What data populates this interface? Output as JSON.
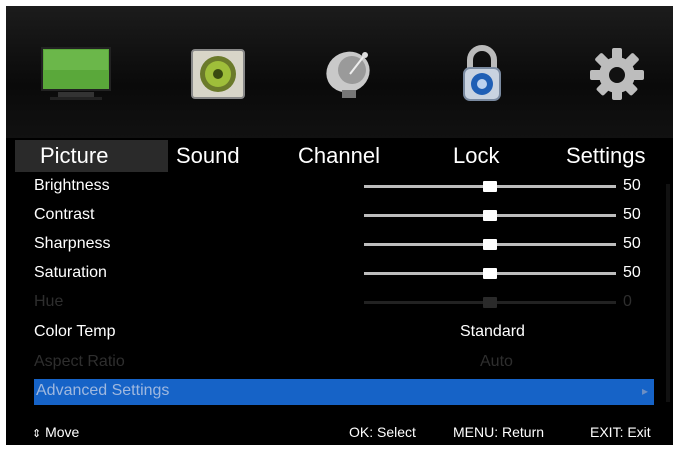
{
  "tabs": [
    {
      "label": "Picture",
      "active": true
    },
    {
      "label": "Sound",
      "active": false
    },
    {
      "label": "Channel",
      "active": false
    },
    {
      "label": "Lock",
      "active": false
    },
    {
      "label": "Settings",
      "active": false
    }
  ],
  "icons": [
    "monitor-icon",
    "speaker-icon",
    "satellite-dish-icon",
    "padlock-icon",
    "gear-icon"
  ],
  "rows": [
    {
      "label": "Brightness",
      "value": "50",
      "level": 0.5,
      "enabled": true
    },
    {
      "label": "Contrast",
      "value": "50",
      "level": 0.5,
      "enabled": true
    },
    {
      "label": "Sharpness",
      "value": "50",
      "level": 0.5,
      "enabled": true
    },
    {
      "label": "Saturation",
      "value": "50",
      "level": 0.5,
      "enabled": true
    },
    {
      "label": "Hue",
      "value": "0",
      "level": 0.5,
      "enabled": false
    }
  ],
  "color_temp": {
    "label": "Color Temp",
    "value": "Standard"
  },
  "aspect_ratio": {
    "label": "Aspect Ratio",
    "value": "Auto",
    "enabled": false
  },
  "advanced": {
    "label": "Advanced Settings"
  },
  "footer": {
    "move": "Move",
    "select": "OK: Select",
    "menu": "MENU: Return",
    "exit": "EXIT: Exit"
  },
  "colors": {
    "selection": "#1663c7",
    "background": "#000000",
    "text": "#ffffff"
  }
}
